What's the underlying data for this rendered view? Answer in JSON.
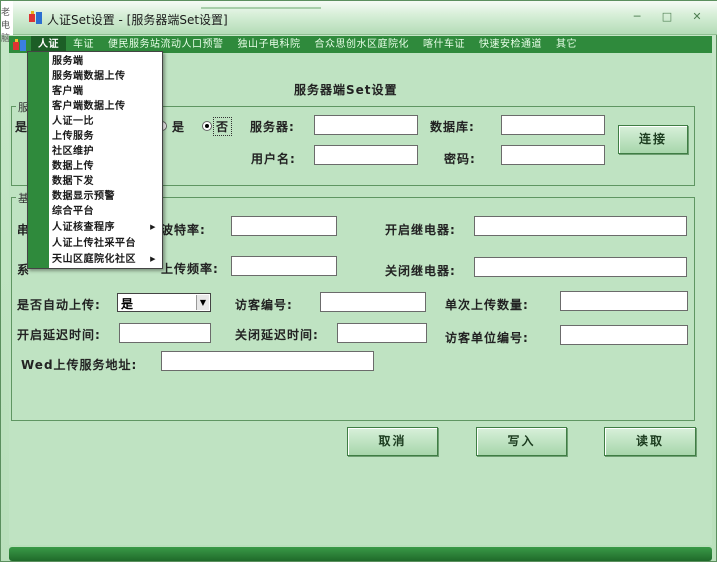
{
  "window": {
    "title": "人证Set设置 - [服务器端Set设置]",
    "side_text": "老电脑",
    "controls": [
      "─",
      "□",
      "✕"
    ]
  },
  "menubar": {
    "items": [
      {
        "label": "人证",
        "active": true
      },
      {
        "label": "车证"
      },
      {
        "label": "便民服务站流动人口预警"
      },
      {
        "label": "独山子电科院"
      },
      {
        "label": "合众思创水区庭院化"
      },
      {
        "label": "喀什车证"
      },
      {
        "label": "快速安检通道"
      },
      {
        "label": "其它"
      }
    ]
  },
  "dropdown": {
    "items": [
      {
        "label": "服务端"
      },
      {
        "label": "服务端数据上传"
      },
      {
        "label": "客户端"
      },
      {
        "label": "客户端数据上传"
      },
      {
        "label": "人证一比"
      },
      {
        "label": "上传服务"
      },
      {
        "label": "社区维护"
      },
      {
        "label": "数据上传"
      },
      {
        "label": "数据下发"
      },
      {
        "label": "数据显示预警"
      },
      {
        "label": "综合平台"
      },
      {
        "label": "人证核查程序",
        "submenu": true
      },
      {
        "label": "人证上传社采平台"
      },
      {
        "label": "天山区庭院化社区",
        "submenu": true
      }
    ]
  },
  "form": {
    "title": "服务器端Set设置",
    "group1": {
      "label": "服",
      "left_label": "是",
      "radio_yes": "是",
      "radio_no": "否",
      "server_label": "服务器:",
      "server_value": "",
      "database_label": "数据库:",
      "database_value": "",
      "username_label": "用户名:",
      "username_value": "",
      "password_label": "密码:",
      "password_value": "",
      "connect_button": "连接"
    },
    "group2": {
      "label": "基",
      "row1_left": "串",
      "baud_label": "波特率:",
      "baud_value": "",
      "open_relay_label": "开启继电器:",
      "open_relay_value": "",
      "row2_left": "系",
      "upload_freq_label": "上传频率:",
      "upload_freq_value": "",
      "close_relay_label": "关闭继电器:",
      "close_relay_value": "",
      "auto_upload_label": "是否自动上传:",
      "auto_upload_value": "是",
      "visitor_no_label": "访客编号:",
      "visitor_no_value": "",
      "single_upload_label": "单次上传数量:",
      "single_upload_value": "",
      "open_delay_label": "开启延迟时间:",
      "open_delay_value": "",
      "close_delay_label": "关闭延迟时间:",
      "close_delay_value": "",
      "visitor_unit_label": "访客单位编号:",
      "visitor_unit_value": "",
      "web_upload_label": "Wed上传服务地址:",
      "web_upload_value": ""
    },
    "buttons": {
      "cancel": "取消",
      "write": "写入",
      "read": "读取"
    }
  },
  "colors": {
    "menubar": "#2f8a3c",
    "window_bg": "#bfe3c2",
    "border": "#5f9662"
  }
}
